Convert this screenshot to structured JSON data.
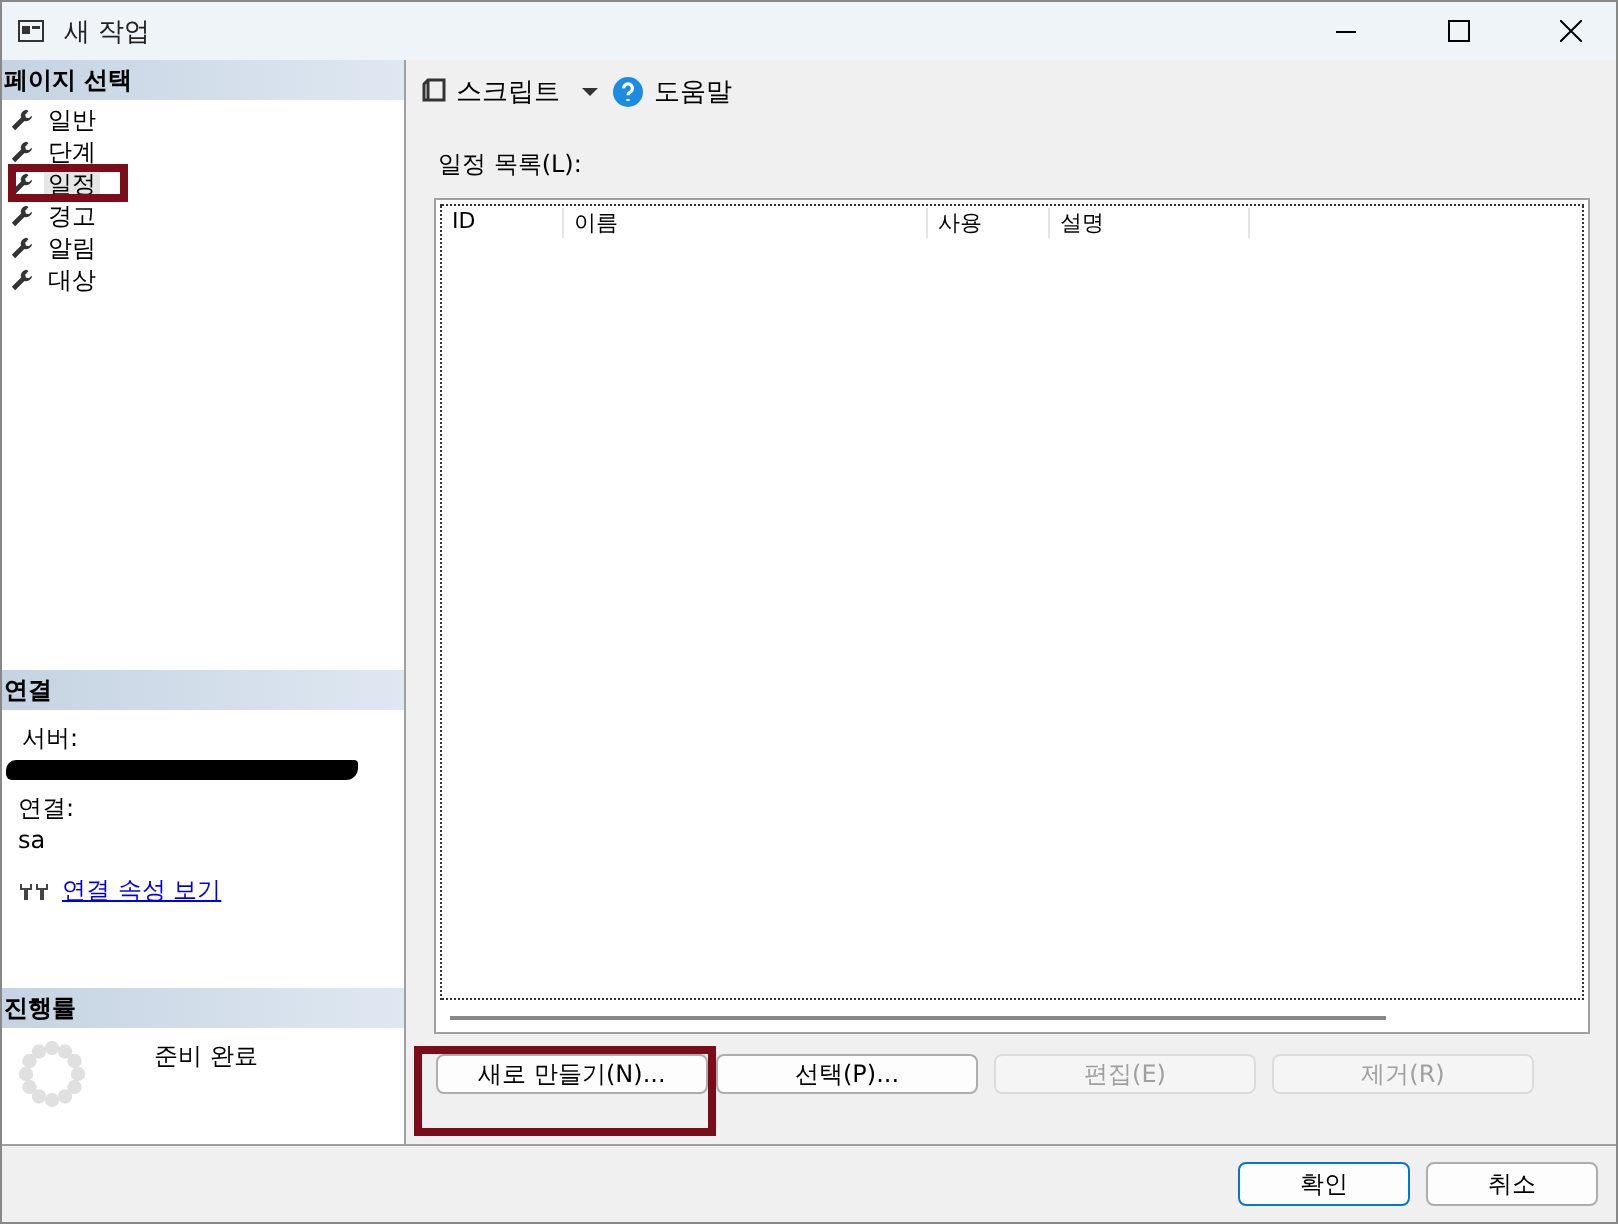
{
  "window": {
    "title": "새 작업"
  },
  "sidebar": {
    "header": "페이지 선택",
    "pages": [
      {
        "label": "일반",
        "selected": false
      },
      {
        "label": "단계",
        "selected": false
      },
      {
        "label": "일정",
        "selected": true
      },
      {
        "label": "경고",
        "selected": false
      },
      {
        "label": "알림",
        "selected": false
      },
      {
        "label": "대상",
        "selected": false
      }
    ]
  },
  "connection": {
    "header": "연결",
    "server_label": "서버:",
    "connection_label": "연결:",
    "connection_value": "sa",
    "link": "연결 속성 보기"
  },
  "progress": {
    "header": "진행률",
    "status": "준비 완료"
  },
  "toolbar": {
    "script": "스크립트",
    "help": "도움말"
  },
  "schedule_list": {
    "label": "일정 목록(L):",
    "columns": [
      "ID",
      "이름",
      "사용",
      "설명"
    ]
  },
  "list_buttons": [
    {
      "label": "새로 만들기(N)...",
      "disabled": false
    },
    {
      "label": "선택(P)...",
      "disabled": false
    },
    {
      "label": "편집(E)",
      "disabled": true
    },
    {
      "label": "제거(R)",
      "disabled": true
    }
  ],
  "dialog_buttons": [
    {
      "label": "확인",
      "default": true
    },
    {
      "label": "취소",
      "default": false
    }
  ]
}
